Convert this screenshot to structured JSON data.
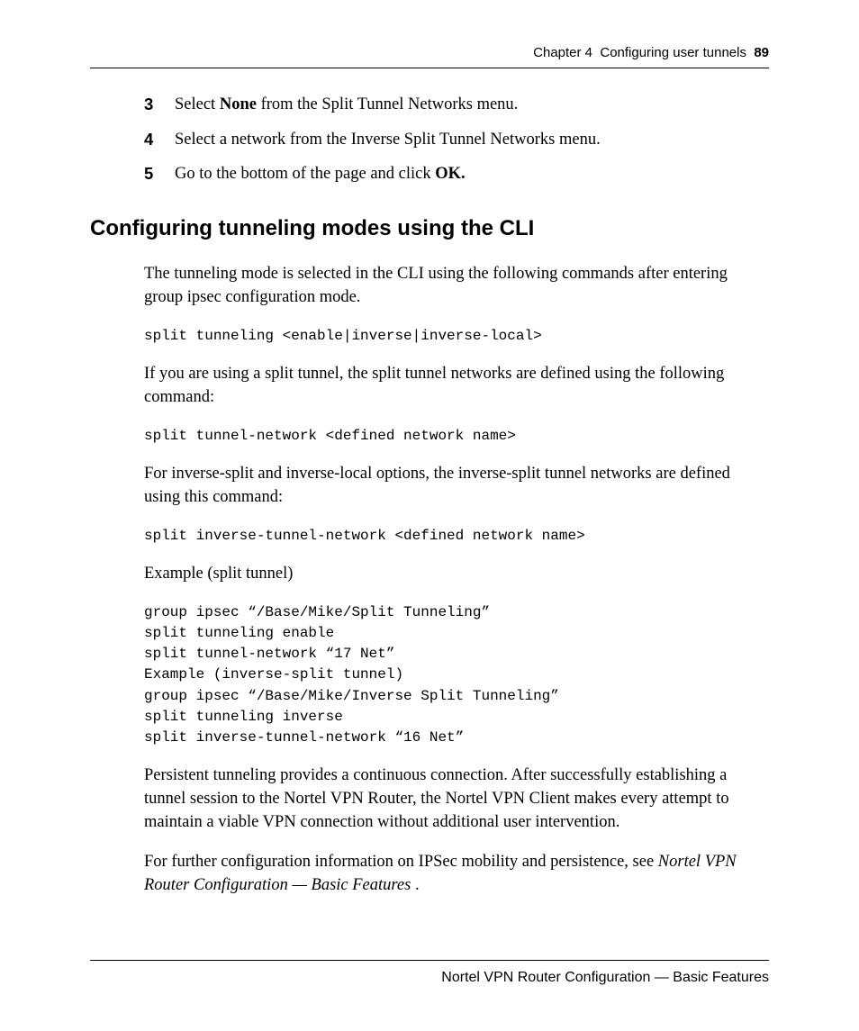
{
  "header": {
    "chapter": "Chapter 4",
    "title": "Configuring user tunnels",
    "page_number": "89"
  },
  "steps": [
    {
      "num": "3",
      "pre": "Select ",
      "bold": "None",
      "post": " from the Split Tunnel Networks menu."
    },
    {
      "num": "4",
      "pre": "Select a network from the Inverse Split Tunnel Networks menu.",
      "bold": "",
      "post": ""
    },
    {
      "num": "5",
      "pre": "Go to the bottom of the page and click ",
      "bold": "OK.",
      "post": ""
    }
  ],
  "section_heading": "Configuring tunneling modes using the CLI",
  "para1": "The tunneling mode is selected in the CLI using the following commands after entering group ipsec configuration mode.",
  "code1": "split tunneling <enable|inverse|inverse-local>",
  "para2": "If you are using a split tunnel, the split tunnel networks are defined using the following command:",
  "code2": "split tunnel-network <defined network name>",
  "para3": "For inverse-split and inverse-local options, the inverse-split tunnel networks are defined using this command:",
  "code3": "split inverse-tunnel-network <defined network name>",
  "para4": "Example (split tunnel)",
  "code4": "group ipsec “/Base/Mike/Split Tunneling”\nsplit tunneling enable\nsplit tunnel-network “17 Net”\nExample (inverse-split tunnel)\ngroup ipsec “/Base/Mike/Inverse Split Tunneling”\nsplit tunneling inverse\nsplit inverse-tunnel-network “16 Net”",
  "para5": "Persistent tunneling provides a continuous connection. After successfully establishing a tunnel session to the Nortel VPN Router, the Nortel VPN Client makes every attempt to maintain a viable VPN connection without additional user intervention.",
  "para6_pre": "For further configuration information on IPSec mobility and persistence, see ",
  "para6_italic": "Nortel VPN Router Configuration — Basic Features",
  "para6_post": " .",
  "footer": "Nortel VPN Router Configuration — Basic Features"
}
